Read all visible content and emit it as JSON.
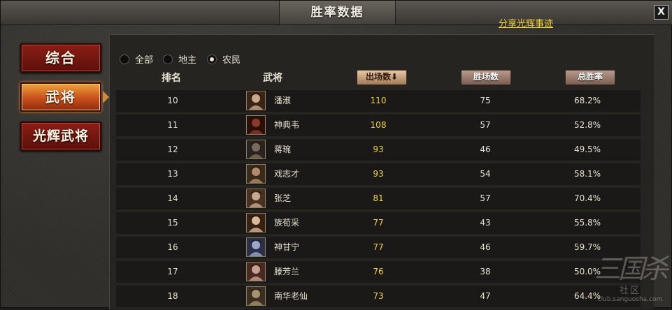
{
  "title": "胜率数据",
  "close_label": "X",
  "share_link": "分享光辉事迹",
  "nav": [
    {
      "label": "综合",
      "active": false
    },
    {
      "label": "武将",
      "active": true
    },
    {
      "label": "光辉武将",
      "active": false
    }
  ],
  "filters": [
    {
      "label": "全部",
      "checked": false
    },
    {
      "label": "地主",
      "checked": false
    },
    {
      "label": "农民",
      "checked": true
    }
  ],
  "columns": {
    "rank": "排名",
    "general": "武将",
    "games": "出场数⬇",
    "wins": "胜场数",
    "rate": "总胜率"
  },
  "rows": [
    {
      "rank": "10",
      "name": "潘淑",
      "games": "110",
      "wins": "75",
      "rate": "68.2%",
      "avatar": "general-portrait"
    },
    {
      "rank": "11",
      "name": "神典韦",
      "games": "108",
      "wins": "57",
      "rate": "52.8%",
      "avatar": "general-portrait"
    },
    {
      "rank": "12",
      "name": "蒋琬",
      "games": "93",
      "wins": "46",
      "rate": "49.5%",
      "avatar": "general-portrait"
    },
    {
      "rank": "13",
      "name": "戏志才",
      "games": "93",
      "wins": "54",
      "rate": "58.1%",
      "avatar": "general-portrait"
    },
    {
      "rank": "14",
      "name": "张芝",
      "games": "81",
      "wins": "57",
      "rate": "70.4%",
      "avatar": "general-portrait"
    },
    {
      "rank": "15",
      "name": "族荀采",
      "games": "77",
      "wins": "43",
      "rate": "55.8%",
      "avatar": "general-portrait"
    },
    {
      "rank": "16",
      "name": "神甘宁",
      "games": "77",
      "wins": "46",
      "rate": "59.7%",
      "avatar": "general-portrait"
    },
    {
      "rank": "17",
      "name": "滕芳兰",
      "games": "76",
      "wins": "38",
      "rate": "50.0%",
      "avatar": "general-portrait"
    },
    {
      "rank": "18",
      "name": "南华老仙",
      "games": "73",
      "wins": "47",
      "rate": "64.4%",
      "avatar": "general-portrait"
    }
  ],
  "watermark": {
    "logo_text": "三国杀",
    "sub": "社区",
    "url": "club.sanguosha.com"
  },
  "colors": {
    "accent_yellow": "#efd34a",
    "nav_red": "#7a1710",
    "nav_active": "#e07a2a"
  }
}
